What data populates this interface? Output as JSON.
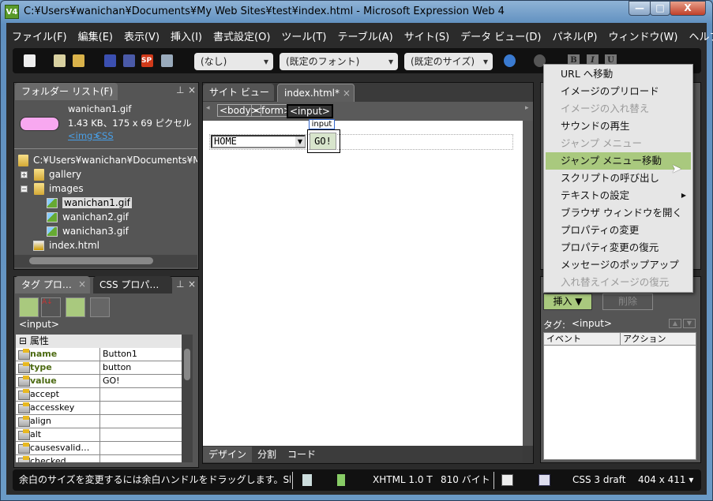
{
  "window": {
    "title": "C:¥Users¥wanichan¥Documents¥My Web Sites¥test¥index.html - Microsoft Expression Web 4",
    "app_icon": "V4",
    "minimize": "—",
    "maximize": "□",
    "close": "X"
  },
  "menubar": [
    "ファイル(F)",
    "編集(E)",
    "表示(V)",
    "挿入(I)",
    "書式設定(O)",
    "ツール(T)",
    "テーブル(A)",
    "サイト(S)",
    "データ ビュー(D)",
    "パネル(P)",
    "ウィンドウ(W)",
    "ヘルプ(H)"
  ],
  "toolbar": {
    "style": "(なし)",
    "font": "(既定のフォント)",
    "size": "(既定のサイズ)",
    "bold": "B",
    "italic": "I",
    "underline": "U",
    "sp_icon": "SP"
  },
  "folder_panel": {
    "title": "フォルダー リスト(F)",
    "preview": {
      "filename": "wanichan1.gif",
      "info": "1.43 KB、175 x 69 ピクセル",
      "link_img": "<img>",
      "link_css": "CSS"
    },
    "root": "C:¥Users¥wanichan¥Documents¥My Web Sites¥test",
    "items": [
      {
        "label": "gallery",
        "type": "folder",
        "expanded": false
      },
      {
        "label": "images",
        "type": "folder",
        "expanded": true
      },
      {
        "label": "wanichan1.gif",
        "type": "image",
        "selected": true
      },
      {
        "label": "wanichan2.gif",
        "type": "image"
      },
      {
        "label": "wanichan3.gif",
        "type": "image"
      },
      {
        "label": "index.html",
        "type": "html"
      }
    ]
  },
  "tag_panel": {
    "tab1": "タグ プロ…",
    "tab2": "CSS プロパ…",
    "current_tag": "<input>",
    "section": "属性",
    "rows": [
      {
        "k": "name",
        "v": "Button1",
        "set": true
      },
      {
        "k": "type",
        "v": "button",
        "set": true
      },
      {
        "k": "value",
        "v": "GO!",
        "set": true
      },
      {
        "k": "accept",
        "v": ""
      },
      {
        "k": "accesskey",
        "v": ""
      },
      {
        "k": "align",
        "v": ""
      },
      {
        "k": "alt",
        "v": ""
      },
      {
        "k": "causesvalid…",
        "v": ""
      },
      {
        "k": "checked",
        "v": ""
      }
    ]
  },
  "editor": {
    "tabs": [
      {
        "label": "サイト ビュー"
      },
      {
        "label": "index.html*",
        "active": true
      }
    ],
    "breadcrumb": [
      "<body>",
      "<form>",
      "<input>"
    ],
    "select_value": "HOME",
    "button_value": "GO!",
    "tag_label": "input",
    "view_tabs": [
      "デザイン",
      "分割",
      "コード"
    ]
  },
  "behaviors_panel": {
    "insert": "挿入 ▼",
    "delete": "削除",
    "tag_label": "タグ:",
    "tag": "<input>",
    "col_event": "イベント",
    "col_action": "アクション"
  },
  "context_menu": {
    "items": [
      {
        "label": "URL へ移動"
      },
      {
        "label": "イメージのプリロード"
      },
      {
        "label": "イメージの入れ替え",
        "disabled": true
      },
      {
        "label": "サウンドの再生"
      },
      {
        "label": "ジャンプ メニュー",
        "disabled": true
      },
      {
        "label": "ジャンプ メニュー移動",
        "highlighted": true
      },
      {
        "label": "スクリプトの呼び出し"
      },
      {
        "label": "テキストの設定",
        "submenu": true
      },
      {
        "label": "ブラウザ ウィンドウを開く"
      },
      {
        "label": "プロパティの変更"
      },
      {
        "label": "プロパティ変更の復元"
      },
      {
        "label": "メッセージのポップアップ"
      },
      {
        "label": "入れ替えイメージの復元",
        "disabled": true
      }
    ]
  },
  "statusbar": {
    "message": "余白のサイズを変更するには余白ハンドルをドラッグします。Sl",
    "doctype": "XHTML 1.0 T",
    "size": "810 バイト",
    "css": "CSS 3 draft",
    "dimensions": "404 x 411 ▾"
  },
  "colors": {
    "accent": "#a9c97e",
    "dark": "#2b2b2b",
    "panel": "#555555"
  }
}
